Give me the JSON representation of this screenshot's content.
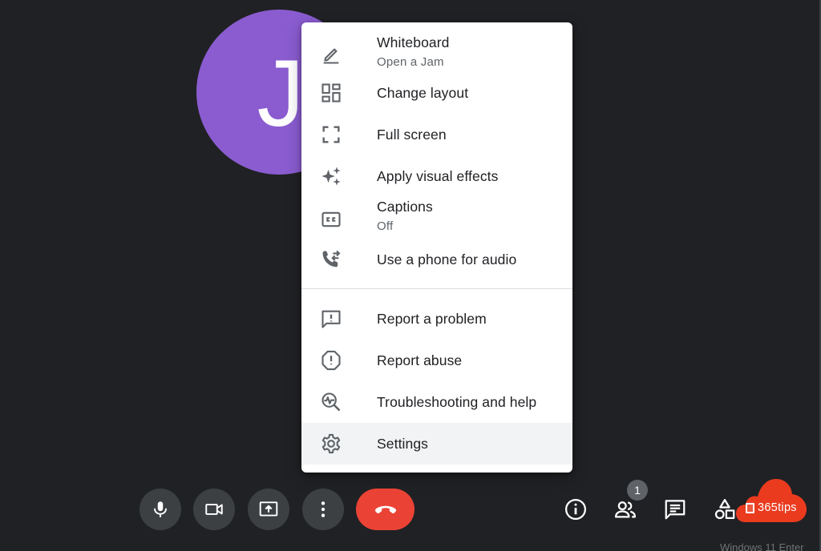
{
  "participant": {
    "initial": "J"
  },
  "menu": {
    "items": [
      {
        "label": "Whiteboard",
        "sublabel": "Open a Jam",
        "icon": "pencil-icon"
      },
      {
        "label": "Change layout",
        "icon": "layout-icon"
      },
      {
        "label": "Full screen",
        "icon": "fullscreen-icon"
      },
      {
        "label": "Apply visual effects",
        "icon": "sparkle-icon"
      },
      {
        "label": "Captions",
        "sublabel": "Off",
        "icon": "captions-icon"
      },
      {
        "label": "Use a phone for audio",
        "icon": "phone-forward-icon"
      },
      {
        "label": "Report a problem",
        "icon": "feedback-icon"
      },
      {
        "label": "Report abuse",
        "icon": "report-icon"
      },
      {
        "label": "Troubleshooting and help",
        "icon": "troubleshoot-icon"
      },
      {
        "label": "Settings",
        "icon": "gear-icon"
      }
    ]
  },
  "controls": {
    "participants_count": "1"
  },
  "brand": {
    "text": "365tips"
  },
  "watermark": "Windows 11 Enter",
  "colors": {
    "background": "#202124",
    "avatar": "#8a5cd0",
    "hangup": "#ea4335",
    "control": "#3c4043",
    "brand": "#ea3b1f"
  }
}
